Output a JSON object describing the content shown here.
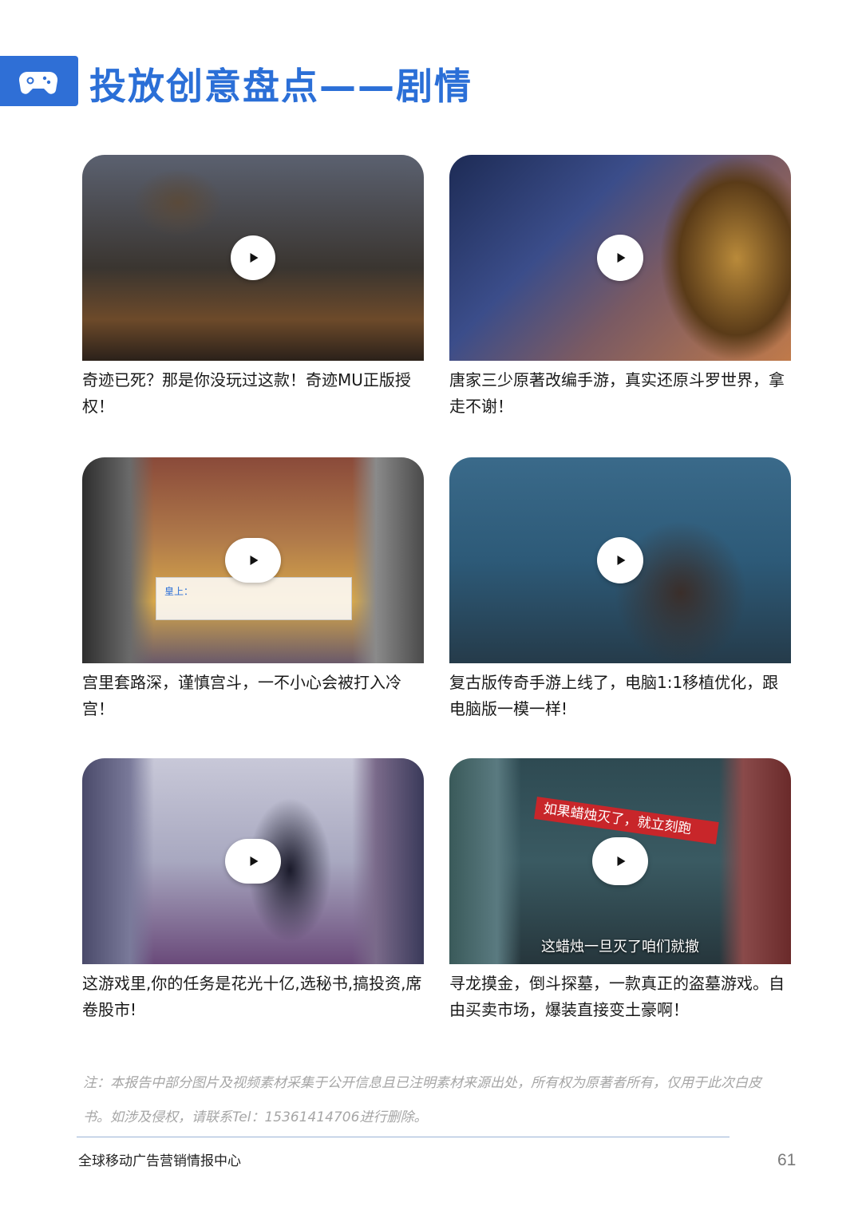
{
  "header": {
    "icon": "gamepad-icon",
    "title": "投放创意盘点——剧情",
    "accent_color": "#2b6fd7"
  },
  "cards": [
    {
      "caption": "奇迹已死？那是你没玩过这款！奇迹MU正版授权！"
    },
    {
      "caption": "唐家三少原著改编手游，真实还原斗罗世界，拿走不谢！"
    },
    {
      "caption": "宫里套路深，谨慎宫斗，一不小心会被打入冷宫！",
      "overlay_text": "皇上："
    },
    {
      "caption": "复古版传奇手游上线了，电脑1:1移植优化，跟电脑版一模一样!"
    },
    {
      "caption": "这游戏里,你的任务是花光十亿,选秘书,搞投资,席卷股市!"
    },
    {
      "caption": "寻龙摸金，倒斗探墓，一款真正的盗墓游戏。自由买卖市场，爆装直接变土豪啊！",
      "ribbon_text": "如果蜡烛灭了，就立刻跑",
      "subtitle_text": "这蜡烛一旦灭了咱们就撤"
    }
  ],
  "footer": {
    "note": "注：本报告中部分图片及视频素材采集于公开信息且已注明素材来源出处，所有权为原著者所有，仅用于此次白皮书。如涉及侵权，请联系Tel：15361414706进行删除。",
    "org": "全球移动广告营销情报中心",
    "page_number": "61"
  }
}
